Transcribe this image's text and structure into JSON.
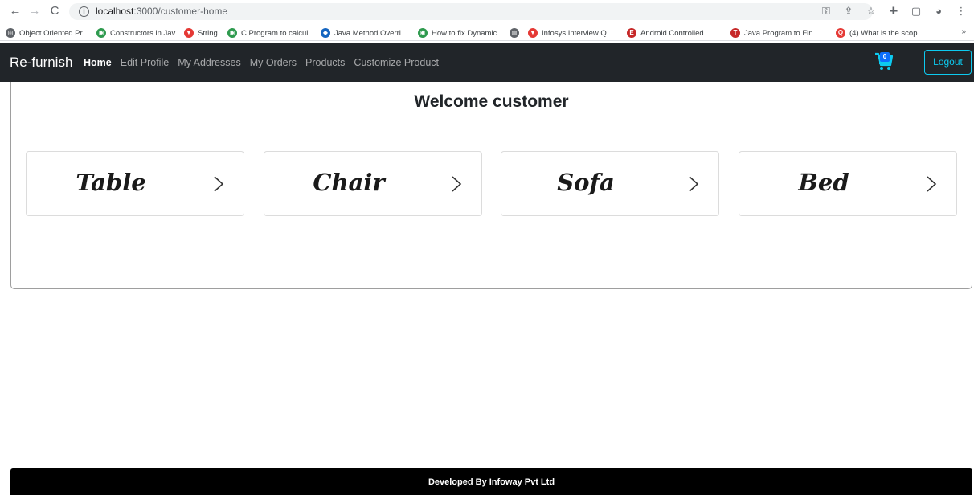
{
  "browser": {
    "url_host": "localhost",
    "url_path": ":3000/customer-home",
    "bookmarks": [
      {
        "label": "Object Oriented Pr...",
        "color": "#5f6368"
      },
      {
        "label": "Constructors in Jav...",
        "color": "#2e9a4e"
      },
      {
        "label": "String",
        "color": "#e53935"
      },
      {
        "label": "C Program to calcul...",
        "color": "#2e9a4e"
      },
      {
        "label": "Java Method Overri...",
        "color": "#1565c0"
      },
      {
        "label": "How to fix Dynamic...",
        "color": "#2e9a4e"
      },
      {
        "label": "",
        "color": "#5f6368"
      },
      {
        "label": "Infosys Interview Q...",
        "color": "#e53935"
      },
      {
        "label": "Android Controlled...",
        "color": "#c62828"
      },
      {
        "label": "Java Program to Fin...",
        "color": "#c62828"
      },
      {
        "label": "(4) What is the scop...",
        "color": "#e53935"
      }
    ],
    "bookmarks_more": "»"
  },
  "navbar": {
    "brand": "Re-furnish",
    "links": [
      "Home",
      "Edit Profile",
      "My Addresses",
      "My Orders",
      "Products",
      "Customize Product"
    ],
    "active": "Home",
    "cart_count": "0",
    "logout_label": "Logout"
  },
  "main": {
    "heading": "Welcome customer",
    "categories": [
      "Table",
      "Chair",
      "Sofa",
      "Bed"
    ]
  },
  "footer": {
    "text": "Developed By Infoway Pvt Ltd"
  },
  "colors": {
    "navbar_bg": "#212529",
    "logout_accent": "#0dcaf0",
    "cart_accent": "#0d6efd",
    "footer_bg": "#000000"
  }
}
